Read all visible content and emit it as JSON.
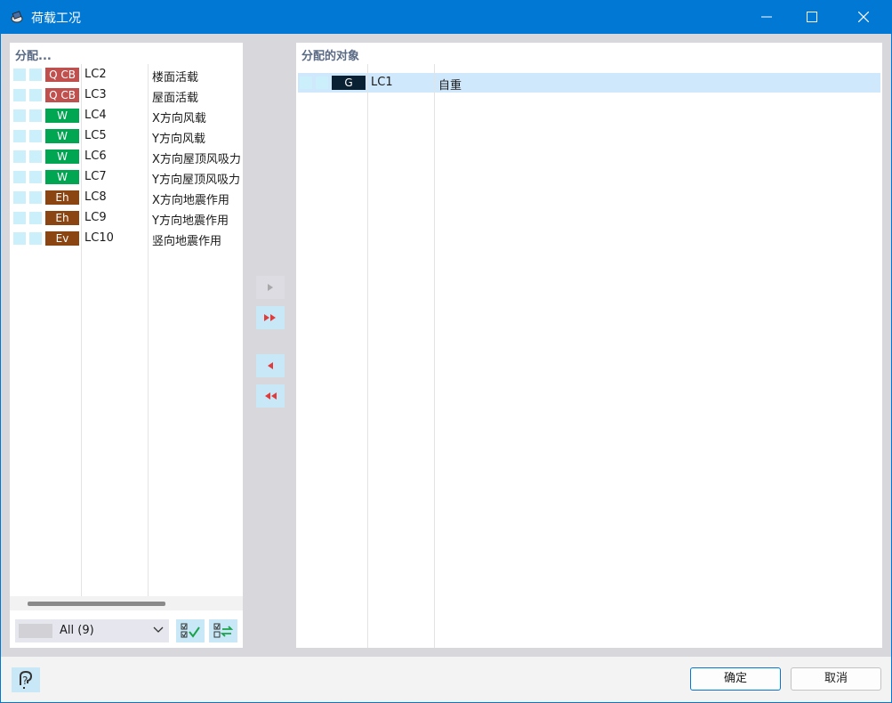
{
  "window": {
    "title": "荷载工况"
  },
  "left_panel": {
    "title": "分配...",
    "rows": [
      {
        "badge": "Q CB",
        "badge_color": "#c0504d",
        "id": "LC2",
        "name": "楼面活载"
      },
      {
        "badge": "Q CB",
        "badge_color": "#c0504d",
        "id": "LC3",
        "name": "屋面活载"
      },
      {
        "badge": "W",
        "badge_color": "#00a651",
        "id": "LC4",
        "name": "X方向风载"
      },
      {
        "badge": "W",
        "badge_color": "#00a651",
        "id": "LC5",
        "name": "Y方向风载"
      },
      {
        "badge": "W",
        "badge_color": "#00a651",
        "id": "LC6",
        "name": "X方向屋顶风吸力"
      },
      {
        "badge": "W",
        "badge_color": "#00a651",
        "id": "LC7",
        "name": "Y方向屋顶风吸力"
      },
      {
        "badge": "Eh",
        "badge_color": "#8b4513",
        "id": "LC8",
        "name": "X方向地震作用"
      },
      {
        "badge": "Eh",
        "badge_color": "#8b4513",
        "id": "LC9",
        "name": "Y方向地震作用"
      },
      {
        "badge": "Ev",
        "badge_color": "#8b4513",
        "id": "LC10",
        "name": "竖向地震作用"
      }
    ],
    "filter": {
      "value": "All (9)"
    }
  },
  "right_panel": {
    "title": "分配的对象",
    "rows": [
      {
        "badge": "G",
        "badge_color": "#0a2033",
        "id": "LC1",
        "name": "自重"
      }
    ]
  },
  "buttons": {
    "ok": "确定",
    "cancel": "取消"
  },
  "colors": {
    "accent": "#0078d4",
    "selection": "#cfe8fb",
    "arrow": "#e03c3c"
  }
}
